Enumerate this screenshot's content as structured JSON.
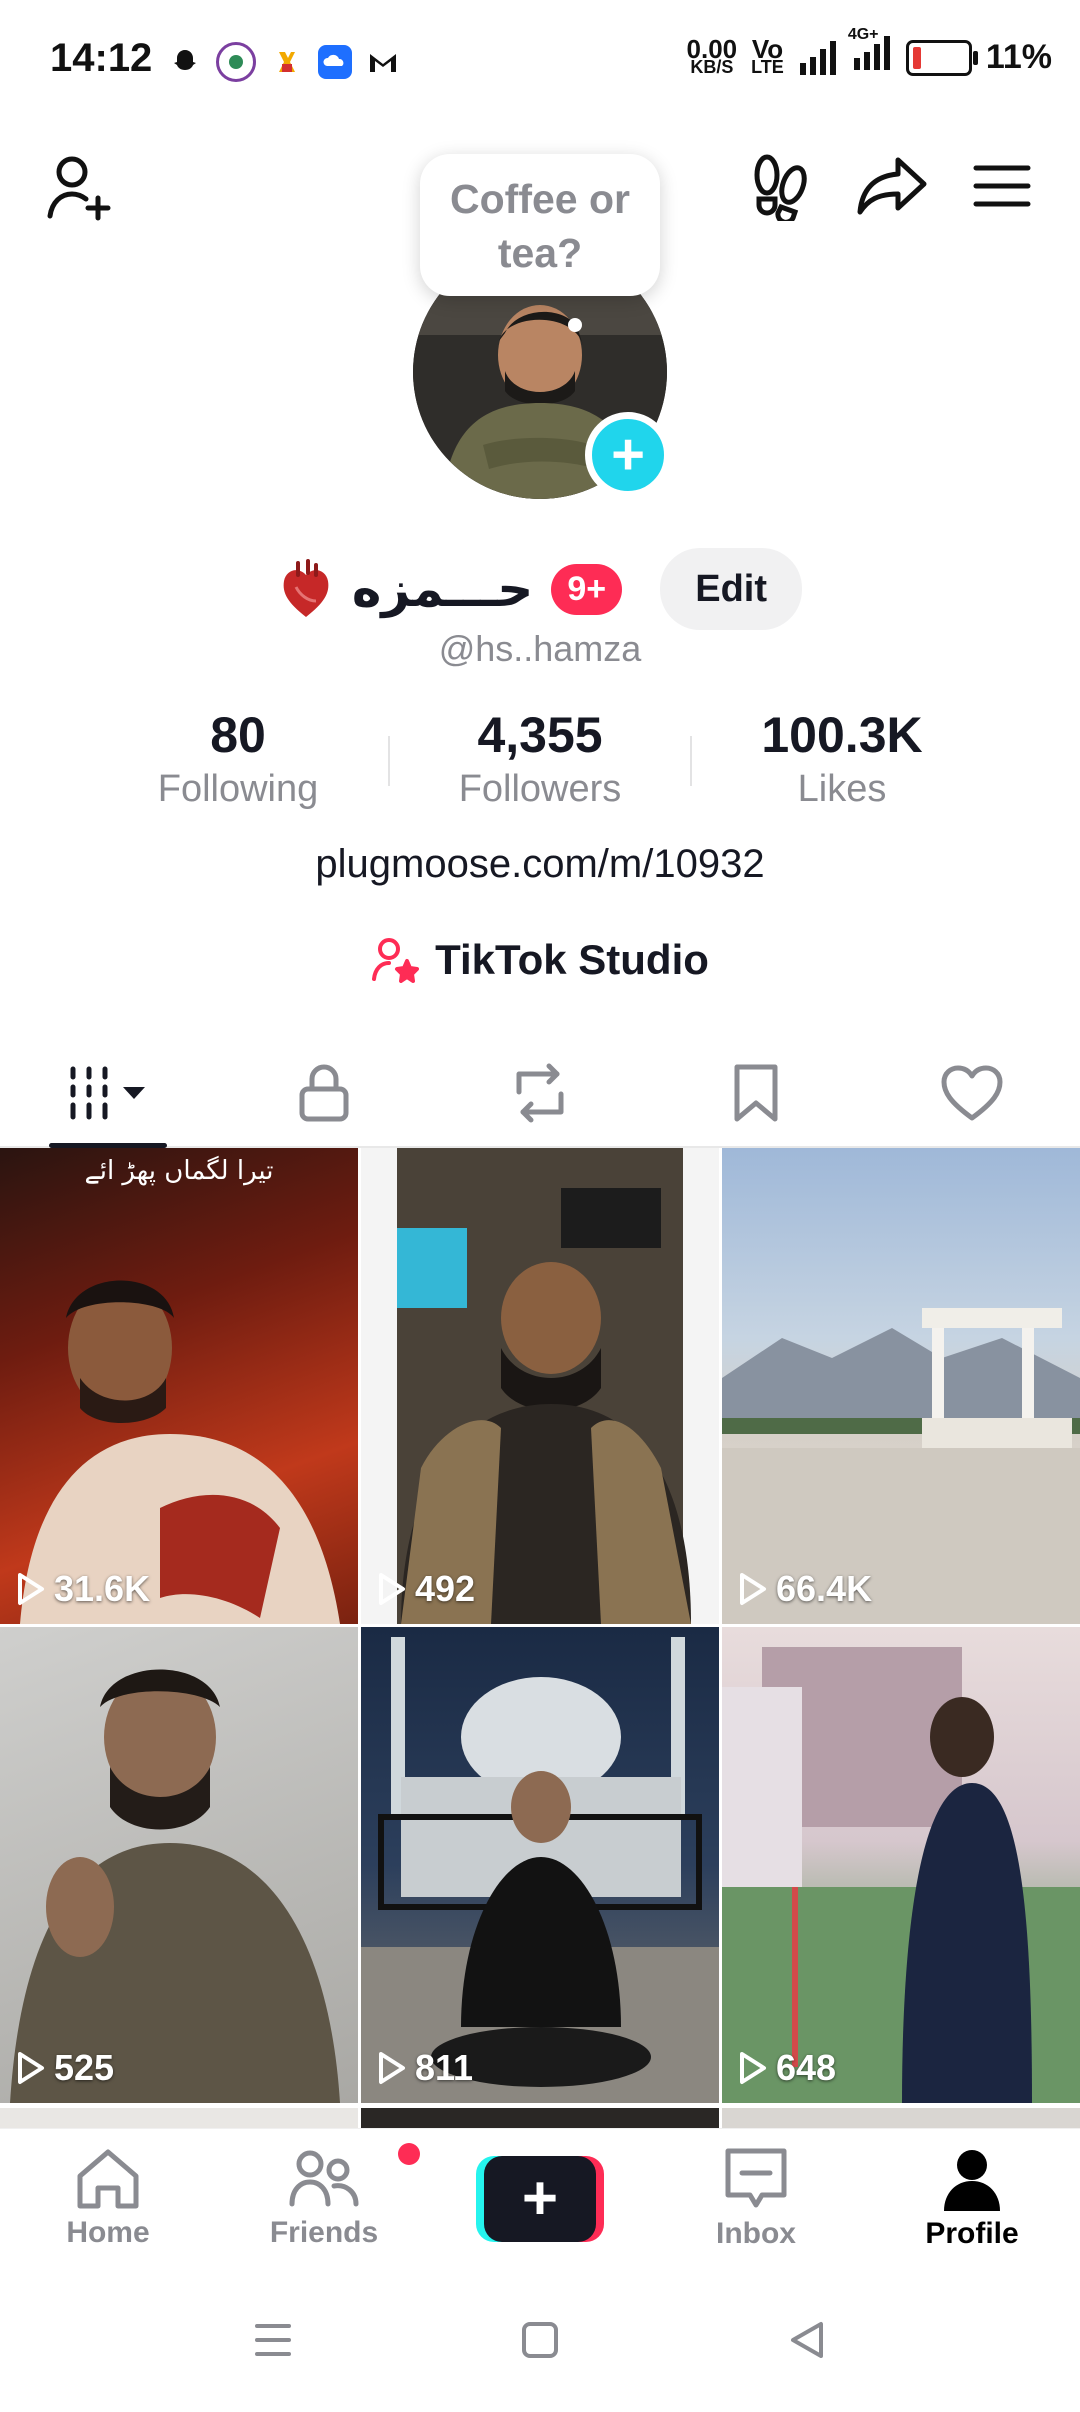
{
  "status_bar": {
    "time": "14:12",
    "net_speed_value": "0.00",
    "net_speed_unit": "KB/S",
    "volte_label_1": "Vo",
    "volte_label_2": "LTE",
    "network_4g": "4G+",
    "battery_percent": "11%",
    "battery_level": 0.11
  },
  "profile": {
    "note_bubble": "Coffee or tea?",
    "display_name": "حـــمزه",
    "notification_badge": "9+",
    "edit_label": "Edit",
    "handle": "@hs..hamza",
    "link": "plugmoose.com/m/10932",
    "studio_label": "TikTok Studio"
  },
  "stats": [
    {
      "value": "80",
      "label": "Following"
    },
    {
      "value": "4,355",
      "label": "Followers"
    },
    {
      "value": "100.3K",
      "label": "Likes"
    }
  ],
  "tabs": [
    {
      "icon": "grid-videos-icon",
      "active": true
    },
    {
      "icon": "lock-icon",
      "active": false
    },
    {
      "icon": "repost-icon",
      "active": false
    },
    {
      "icon": "bookmark-icon",
      "active": false
    },
    {
      "icon": "heart-icon",
      "active": false
    }
  ],
  "videos": [
    {
      "views": "31.6K",
      "overlay_text": "تیرا لگماں پھڑ ائے"
    },
    {
      "views": "492"
    },
    {
      "views": "66.4K"
    },
    {
      "views": "525"
    },
    {
      "views": "811"
    },
    {
      "views": "648"
    }
  ],
  "bottom_nav": [
    {
      "label": "Home",
      "icon": "home-icon"
    },
    {
      "label": "Friends",
      "icon": "friends-icon",
      "has_dot": true
    },
    {
      "label": "",
      "icon": "create-plus-icon"
    },
    {
      "label": "Inbox",
      "icon": "inbox-icon"
    },
    {
      "label": "Profile",
      "icon": "profile-icon",
      "active": true
    }
  ],
  "colors": {
    "accent_red": "#fe2c55",
    "accent_cyan": "#25f4ee",
    "plus_badge": "#20d5ec",
    "text_primary": "#161823",
    "text_secondary": "#8a8b91"
  }
}
